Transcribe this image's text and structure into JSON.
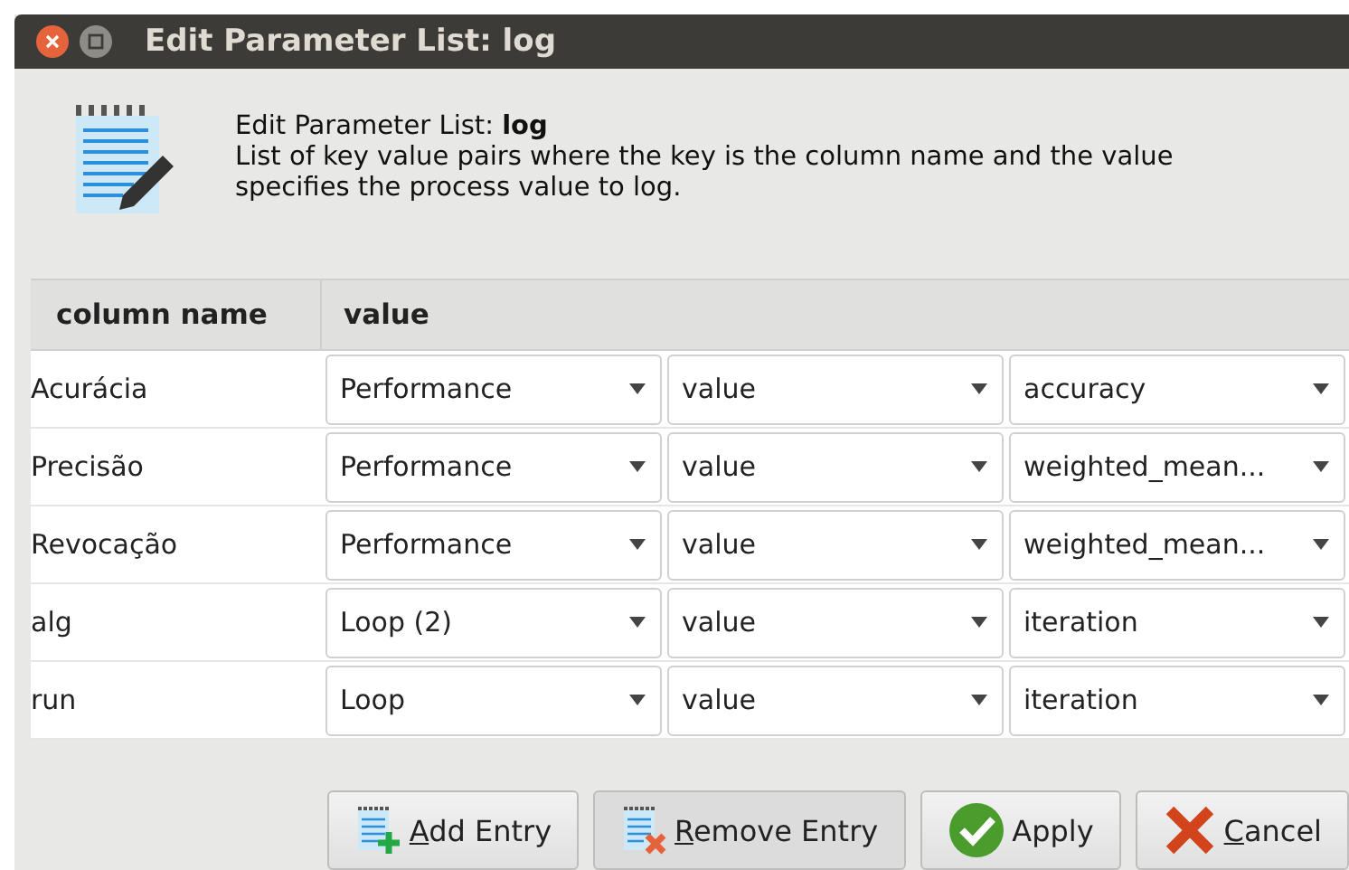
{
  "window": {
    "title": "Edit Parameter List: log"
  },
  "header": {
    "title": "Edit Parameter List: **log**",
    "description": "List of key value pairs where the key is the column name and the value specifies the process value to log."
  },
  "table": {
    "columns": [
      "column name",
      "value"
    ],
    "rows": [
      {
        "name": "Acurácia",
        "operator": "Performance",
        "kind": "value",
        "parameter": "accuracy"
      },
      {
        "name": "Precisão",
        "operator": "Performance",
        "kind": "value",
        "parameter": "weighted_mean..."
      },
      {
        "name": "Revocação",
        "operator": "Performance",
        "kind": "value",
        "parameter": "weighted_mean..."
      },
      {
        "name": "alg",
        "operator": "Loop (2)",
        "kind": "value",
        "parameter": "iteration"
      },
      {
        "name": "run",
        "operator": "Loop",
        "kind": "value",
        "parameter": "iteration"
      }
    ]
  },
  "buttons": [
    {
      "kind": "add",
      "mnemonic": "A",
      "rest": "dd Entry"
    },
    {
      "kind": "remove",
      "mnemonic": "R",
      "rest": "emove Entry"
    },
    {
      "kind": "apply",
      "rest": "Apply"
    },
    {
      "kind": "cancel",
      "mnemonic": "C",
      "rest": "ancel"
    }
  ]
}
